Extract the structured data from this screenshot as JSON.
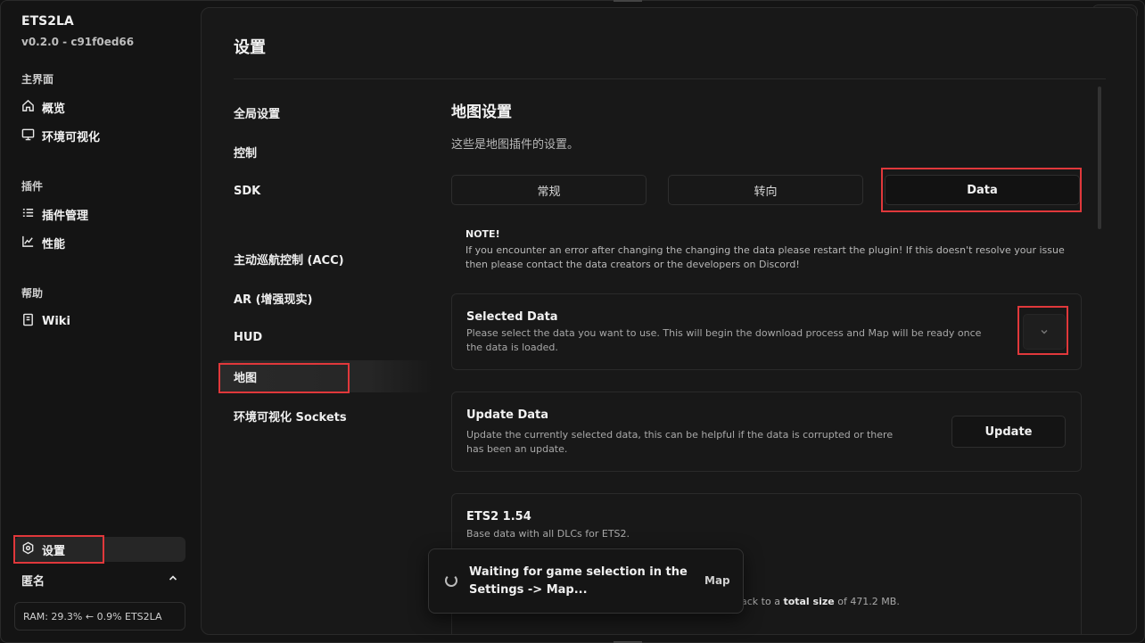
{
  "app": {
    "name": "ETS2LA",
    "version": "v0.2.0 - c91f0ed66"
  },
  "window_controls": {
    "colors": [
      "#28c840",
      "#febc2e",
      "#ff5f57"
    ]
  },
  "sidebar": {
    "sections": [
      {
        "label": "主界面",
        "items": [
          {
            "label": "概览",
            "icon": "home-icon"
          },
          {
            "label": "环境可视化",
            "icon": "monitor-icon"
          }
        ]
      },
      {
        "label": "插件",
        "items": [
          {
            "label": "插件管理",
            "icon": "list-icon"
          },
          {
            "label": "性能",
            "icon": "chart-icon"
          }
        ]
      },
      {
        "label": "帮助",
        "items": [
          {
            "label": "Wiki",
            "icon": "book-icon"
          }
        ]
      }
    ],
    "settings_label": "设置",
    "user": "匿名",
    "ram": "RAM: 29.3% ← 0.9% ETS2LA"
  },
  "main": {
    "title": "设置",
    "settings_nav": [
      {
        "label": "全局设置"
      },
      {
        "label": "控制"
      },
      {
        "label": "SDK"
      },
      {
        "label": "主动巡航控制 (ACC)"
      },
      {
        "label": "AR (增强现实)"
      },
      {
        "label": "HUD"
      },
      {
        "label": "地图",
        "active": true
      },
      {
        "label": "环境可视化 Sockets"
      }
    ],
    "section": {
      "title": "地图设置",
      "description": "这些是地图插件的设置。",
      "tabs": [
        {
          "label": "常规"
        },
        {
          "label": "转向"
        },
        {
          "label": "Data",
          "active": true
        }
      ],
      "note_title": "NOTE!",
      "note_body": "If you encounter an error after changing the changing the data please restart the plugin! If this doesn't resolve your issue then please contact the data creators or the developers on Discord!",
      "selected_data": {
        "title": "Selected Data",
        "description": "Please select the data you want to use. This will begin the download process and Map will be ready once the data is loaded."
      },
      "update_data": {
        "title": "Update Data",
        "description": "Update the currently selected data, this can be helpful if the data is corrupted or there has been an update.",
        "button": "Update"
      },
      "ets2": {
        "title": "ETS2 1.54",
        "description": "Base data with all DLCs for ETS2.",
        "size_prefix": "ack to a ",
        "size_label": "total size",
        "size_suffix": " of 471.2 MB."
      }
    }
  },
  "toast": {
    "message": "Waiting for game selection in the Settings -> Map...",
    "tag": "Map"
  },
  "highlight_color": "#e0383b"
}
